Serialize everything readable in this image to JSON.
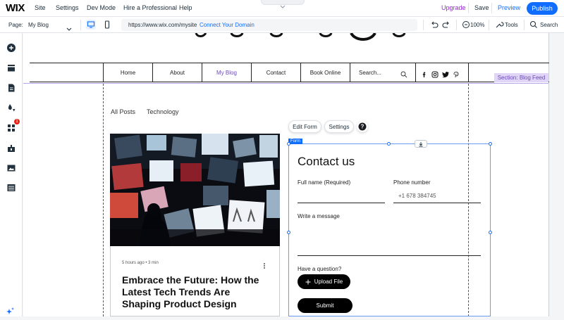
{
  "topbar": {
    "logo": "WIX",
    "menu": [
      "Site",
      "Settings",
      "Dev Mode",
      "Hire a Professional",
      "Help"
    ],
    "upgrade": "Upgrade",
    "save": "Save",
    "preview": "Preview",
    "publish": "Publish"
  },
  "toolbar": {
    "page_label": "Page:",
    "page_value": "My Blog",
    "url": "https://www.wix.com/mysite",
    "connect_domain": "Connect Your Domain",
    "zoom": "100%",
    "tools": "Tools",
    "search": "Search"
  },
  "sidebar": {
    "icons": [
      "add-icon",
      "sections-icon",
      "pages-icon",
      "design-icon",
      "apps-icon",
      "business-icon",
      "media-icon",
      "cms-icon"
    ],
    "apps_badge": "1"
  },
  "site_nav": {
    "items": [
      "Home",
      "About",
      "My Blog",
      "Contact",
      "Book Online"
    ],
    "search_placeholder": "Search...",
    "active_color": "#6a4ab8"
  },
  "section_tag": "Section: Blog Feed",
  "blog": {
    "categories": [
      "All Posts",
      "Technology"
    ],
    "post": {
      "meta": "5 hours ago  •  3 min",
      "title": "Embrace the Future: How the Latest Tech Trends Are Shaping Product Design"
    }
  },
  "form_toolbar": {
    "edit_form": "Edit Form",
    "settings": "Settings",
    "help": "?"
  },
  "form": {
    "tag": "Form",
    "title": "Contact us",
    "full_name_label": "Full name (Required)",
    "phone_label": "Phone number",
    "phone_placeholder": "+1 678 384745",
    "message_label": "Write a message",
    "question_label": "Have a question?",
    "upload_button": "Upload File",
    "submit_button": "Submit"
  },
  "colors": {
    "accent_blue": "#116dff",
    "upgrade_purple": "#9a27d5",
    "section_purple": "#e0d4f7"
  }
}
